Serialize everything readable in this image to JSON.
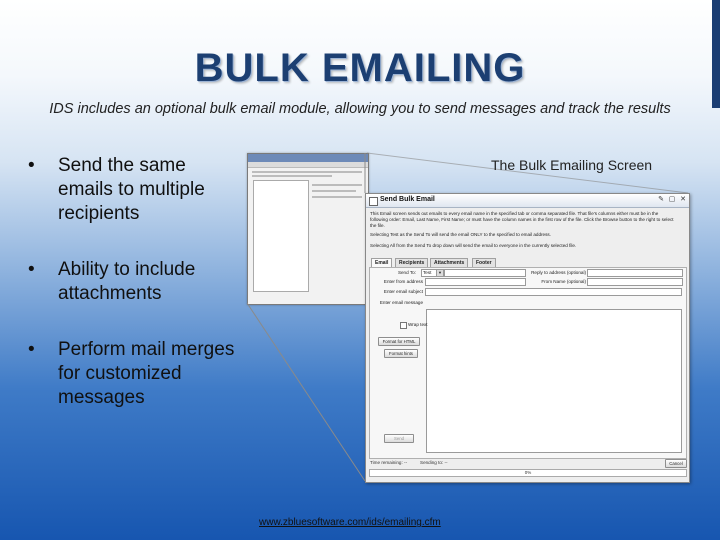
{
  "slide": {
    "title": "BULK EMAILING",
    "subtitle": "IDS includes an optional bulk email module, allowing you to send messages and track the results",
    "bullets": [
      "Send the same emails to multiple recipients",
      "Ability to include attachments",
      "Perform mail merges for customized messages"
    ],
    "bullet_char": "•",
    "screen_label": "The Bulk Emailing Screen",
    "footer_url": "www.zbluesoftware.com/ids/emailing.cfm"
  },
  "dialog": {
    "title": "Send Bulk Email",
    "window_buttons": [
      "✎",
      "▢",
      "✕"
    ],
    "info_lines": [
      "This Email screen sends out emails to every email name in the specified tab or comma separated file. That file's columns either must be in the",
      "following order: Email, Last Name, First Name; or must have the column names in the first row of the file. Click the Browse button to the right to select",
      "the file.",
      "Selecting Test as the Send To will send the email ONLY to the specified to email address.",
      "Selecting All from the Send To drop down will send the email to everyone in the currently selected file."
    ],
    "tabs": [
      "Email",
      "Recipients",
      "Attachments",
      "Footer"
    ],
    "fields": {
      "send_to_label": "Send To:",
      "send_to_value": "Test",
      "reply_to_label": "Reply to address (optional)",
      "from_address_label": "Enter from address",
      "from_name_label": "From Name (optional)",
      "subject_label": "Enter email subject",
      "message_label": "Enter email message"
    },
    "wrap_text_label": "Wrap text",
    "format_html_label": "Format for HTML",
    "format_hints_label": "Format hints",
    "send_label": "Send",
    "cancel_label": "Cancel",
    "time_remaining": "Time remaining: --",
    "sending_to": "Sending to: --",
    "progress": "0%"
  },
  "colors": {
    "title": "#1c3f72",
    "titlebar": "#dfe6f0",
    "background_bottom": "#1756b0"
  }
}
